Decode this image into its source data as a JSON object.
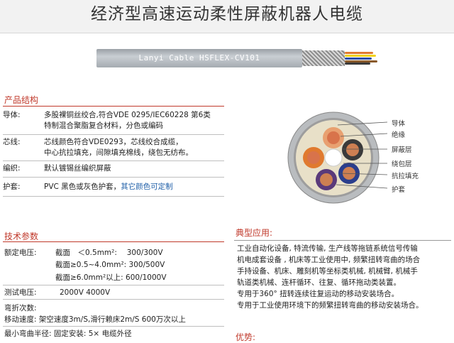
{
  "title": "经济型高速运动柔性屏蔽机器人电缆",
  "cable_label": "Lanyi Cable HSFLEX-CV101",
  "structure": {
    "heading": "产品结构",
    "rows": [
      {
        "key": "导体:",
        "lines": [
          "多股裸铜丝绞合,符合VDE 0295/IEC60228 第6类",
          "特制混合聚脂复合材料，分色或编码"
        ]
      },
      {
        "key": "芯线:",
        "lines": [
          "芯线颜色符合VDE0293，芯线绞合成缆，",
          "中心抗拉填充，间隙填充棉线，绕包无纺布。"
        ]
      },
      {
        "key": "编织:",
        "lines": [
          "默认镀锡丝编织屏蔽"
        ]
      },
      {
        "key": "护套:",
        "lines": [
          "PVC 黑色或灰色护套，"
        ],
        "extra": "其它颜色可定制"
      }
    ]
  },
  "tech": {
    "heading": "技术参数",
    "voltage_label": "额定电压:",
    "voltage_rows": [
      "截面　＜0.5mm²:　 300/300V",
      "截面≥0.5~4.0mm²: 300/500V",
      "截面≥6.0mm²以上: 600/1000V"
    ],
    "test_label": "测试电压:",
    "test_value": "2000V 4000V",
    "bend_label": "弯折次数:",
    "speed": "移动速度: 架空速度3m/S,滑行赖床2m/S 600万次以上",
    "radius": "最小弯曲半径: 固定安装: 5× 电缆外径"
  },
  "callouts": [
    "导体",
    "绝缘",
    "屏蔽层",
    "绕包层",
    "抗拉填充",
    "护套"
  ],
  "application": {
    "heading": "典型应用:",
    "lines": [
      "工业自动化设备, 特流传输, 生产线等拖链系统信号传输",
      "机电成套设备 , 机床等工业使用中, 频繁扭转弯曲的场合",
      "手持设备、机床、雕刻机等坐标类机械, 机械臂, 机械手",
      "轨道类机械、连杆循环、往复、循环拖动类装置。",
      "专用于360° 扭转连续往复运动的移动安装场合。",
      "专用于工业使用环境下的频繁扭转弯曲的移动安装场合。"
    ]
  },
  "advantage_heading": "优势:",
  "colors": {
    "accent": "#c0392b",
    "link": "#1f5fa8"
  }
}
